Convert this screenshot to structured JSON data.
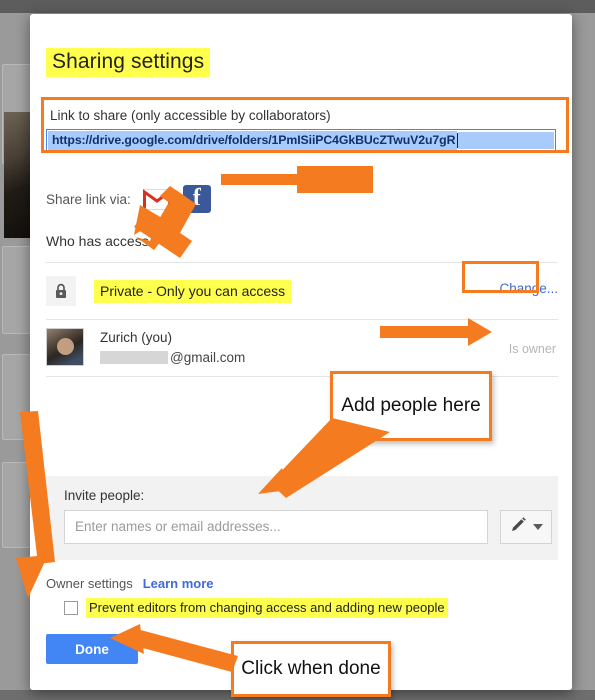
{
  "dialog": {
    "title": "Sharing settings"
  },
  "link_section": {
    "label": "Link to share (only accessible by collaborators)",
    "url": "https://drive.google.com/drive/folders/1PmISiiPC4GkBUcZTwuV2u7gR"
  },
  "share_via": {
    "label": "Share link via:",
    "icons": [
      {
        "name": "gmail-icon",
        "glyph": "M",
        "color": "#d93025"
      },
      {
        "name": "facebook-icon",
        "glyph": "f",
        "color": "#3b5998"
      }
    ]
  },
  "access": {
    "heading": "Who has access",
    "privacy_row": {
      "icon": "lock-icon",
      "label": "Private - Only you can access",
      "action": "Change..."
    },
    "owner_row": {
      "name": "Zurich (you)",
      "email_suffix": "@gmail.com",
      "role": "Is owner"
    }
  },
  "invite": {
    "label": "Invite people:",
    "placeholder": "Enter names or email addresses...",
    "permission_icon": "pencil-icon",
    "dropdown_icon": "chevron-down-icon"
  },
  "owner_settings": {
    "label": "Owner settings",
    "learn_more": "Learn more",
    "checkbox_label": "Prevent editors from changing access and adding new people",
    "checked": false
  },
  "footer": {
    "done_label": "Done"
  },
  "annotations": {
    "add_people": "Add people here",
    "click_when_done": "Click when done",
    "accent_color": "#f47b20",
    "highlight_color": "#ffff4d",
    "link_color": "#3f6ad8",
    "primary_button_color": "#4285f4"
  }
}
